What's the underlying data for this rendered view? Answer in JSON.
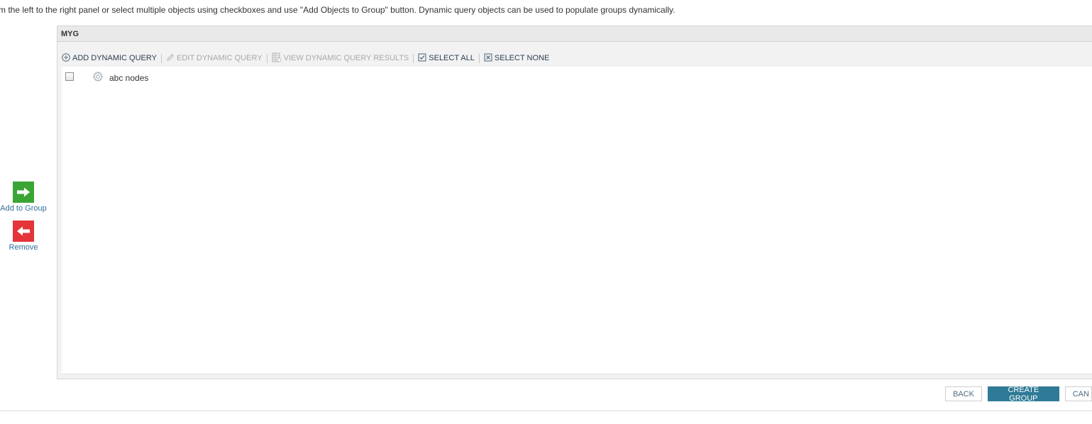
{
  "instructions": "m the left to the right panel or select multiple objects using checkboxes and use \"Add Objects to Group\" button. Dynamic query objects can be used to populate groups dynamically.",
  "side_actions": {
    "add_label": "Add to Group",
    "remove_label": "Remove"
  },
  "panel": {
    "title": "MYG",
    "toolbar": {
      "add_dynamic_query": "ADD DYNAMIC QUERY",
      "edit_dynamic_query": "EDIT DYNAMIC QUERY",
      "view_dynamic_query_results": "VIEW DYNAMIC QUERY RESULTS",
      "select_all": "SELECT ALL",
      "select_none": "SELECT NONE"
    },
    "items": [
      {
        "label": "abc nodes",
        "icon": "gear-icon",
        "checked": false
      }
    ]
  },
  "footer": {
    "back_label": "BACK",
    "create_group_label": "CREATE GROUP",
    "cancel_label": "CAN"
  },
  "colors": {
    "add_green": "#3aa535",
    "remove_red": "#e4353b",
    "primary_button": "#2f7a96",
    "link_blue": "#2f6e95"
  }
}
